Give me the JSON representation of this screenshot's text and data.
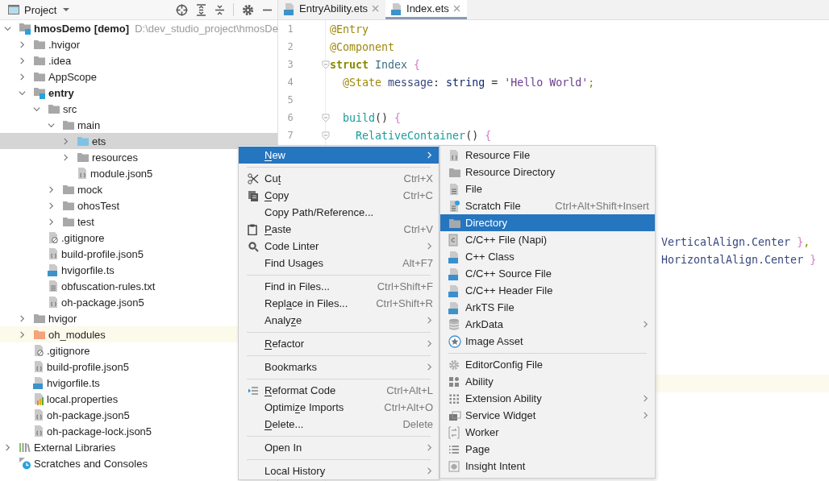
{
  "project_panel": {
    "title": "Project"
  },
  "tree": [
    {
      "label": "hmosDemo",
      "tag": "[demo]",
      "path": "D:\\dev_studio_project\\hmosDe",
      "kind": "module",
      "expanded": true,
      "selected": false,
      "highlighted": false,
      "children": [
        {
          "label": ".hvigor",
          "kind": "folder",
          "expanded": false,
          "selected": false,
          "highlighted": false
        },
        {
          "label": ".idea",
          "kind": "folder",
          "expanded": false,
          "selected": false,
          "highlighted": false
        },
        {
          "label": "AppScope",
          "kind": "folder",
          "expanded": false,
          "selected": false,
          "highlighted": false
        },
        {
          "label": "entry",
          "kind": "module",
          "expanded": true,
          "selected": false,
          "highlighted": false,
          "children": [
            {
              "label": "src",
              "kind": "folder",
              "expanded": true,
              "selected": false,
              "highlighted": false,
              "children": [
                {
                  "label": "main",
                  "kind": "folder",
                  "expanded": true,
                  "selected": false,
                  "highlighted": false,
                  "children": [
                    {
                      "label": "ets",
                      "kind": "source-folder",
                      "expanded": false,
                      "selected": true,
                      "highlighted": false
                    },
                    {
                      "label": "resources",
                      "kind": "folder",
                      "expanded": false,
                      "selected": false,
                      "highlighted": false
                    },
                    {
                      "label": "module.json5",
                      "kind": "json",
                      "selected": false,
                      "highlighted": false
                    }
                  ]
                },
                {
                  "label": "mock",
                  "kind": "folder",
                  "expanded": false,
                  "selected": false,
                  "highlighted": false
                },
                {
                  "label": "ohosTest",
                  "kind": "folder",
                  "expanded": false,
                  "selected": false,
                  "highlighted": false
                },
                {
                  "label": "test",
                  "kind": "folder",
                  "expanded": false,
                  "selected": false,
                  "highlighted": false
                }
              ]
            },
            {
              "label": ".gitignore",
              "kind": "ignore",
              "selected": false,
              "highlighted": false
            },
            {
              "label": "build-profile.json5",
              "kind": "json",
              "selected": false,
              "highlighted": false
            },
            {
              "label": "hvigorfile.ts",
              "kind": "ts",
              "selected": false,
              "highlighted": false
            },
            {
              "label": "obfuscation-rules.txt",
              "kind": "txt",
              "selected": false,
              "highlighted": false
            },
            {
              "label": "oh-package.json5",
              "kind": "json",
              "selected": false,
              "highlighted": false
            }
          ]
        },
        {
          "label": "hvigor",
          "kind": "folder",
          "expanded": false,
          "selected": false,
          "highlighted": false
        },
        {
          "label": "oh_modules",
          "kind": "excluded-folder",
          "expanded": false,
          "selected": false,
          "highlighted": true
        },
        {
          "label": ".gitignore",
          "kind": "ignore",
          "selected": false,
          "highlighted": false
        },
        {
          "label": "build-profile.json5",
          "kind": "json",
          "selected": false,
          "highlighted": false
        },
        {
          "label": "hvigorfile.ts",
          "kind": "ts",
          "selected": false,
          "highlighted": false
        },
        {
          "label": "local.properties",
          "kind": "properties",
          "selected": false,
          "highlighted": false
        },
        {
          "label": "oh-package.json5",
          "kind": "json",
          "selected": false,
          "highlighted": false
        },
        {
          "label": "oh-package-lock.json5",
          "kind": "json",
          "selected": false,
          "highlighted": false
        }
      ]
    },
    {
      "label": "External Libraries",
      "kind": "libraries",
      "expanded": false,
      "selected": false,
      "highlighted": false
    },
    {
      "label": "Scratches and Consoles",
      "kind": "scratches",
      "selected": false,
      "highlighted": false
    }
  ],
  "tabs": [
    {
      "label": "EntryAbility.ets",
      "selected": false
    },
    {
      "label": "Index.ets",
      "selected": true
    }
  ],
  "code_lines": [
    {
      "number": "1",
      "fold": false,
      "tokens": [
        {
          "text": "@Entry",
          "kind": "annotation"
        }
      ]
    },
    {
      "number": "2",
      "fold": false,
      "tokens": [
        {
          "text": "@Component",
          "kind": "annotation"
        }
      ]
    },
    {
      "number": "3",
      "fold": true,
      "tokens": [
        {
          "text": "struct",
          "kind": "keyword"
        },
        {
          "text": " Index",
          "kind": "type"
        },
        {
          "text": " {",
          "kind": "brace"
        }
      ]
    },
    {
      "number": "4",
      "fold": false,
      "tokens": [
        {
          "text": "  @State",
          "kind": "annotation"
        },
        {
          "text": " message",
          "kind": "field"
        },
        {
          "text": ": ",
          "kind": "plain"
        },
        {
          "text": "string",
          "kind": "builtin"
        },
        {
          "text": " = ",
          "kind": "plain"
        },
        {
          "text": "'Hello World'",
          "kind": "string"
        },
        {
          "text": ";",
          "kind": "punct"
        }
      ]
    },
    {
      "number": "5",
      "fold": false
    },
    {
      "number": "6",
      "fold": true,
      "tokens": [
        {
          "text": "  build",
          "kind": "func"
        },
        {
          "text": "()",
          "kind": "plain"
        },
        {
          "text": " {",
          "kind": "brace"
        }
      ]
    },
    {
      "number": "7",
      "fold": true,
      "tokens": [
        {
          "text": "    RelativeContainer",
          "kind": "func"
        },
        {
          "text": "()",
          "kind": "plain"
        },
        {
          "text": " {",
          "kind": "brace"
        }
      ]
    }
  ],
  "clipped_lines": [
    {
      "tokens": [
        {
          "text": "VerticalAlign",
          "kind": "field"
        },
        {
          "text": ".Center",
          "kind": "field"
        },
        {
          "text": " }",
          "kind": "brace"
        },
        {
          "text": ",",
          "kind": "punct"
        }
      ]
    },
    {
      "tokens": [
        {
          "text": "HorizontalAlign",
          "kind": "field"
        },
        {
          "text": ".Center",
          "kind": "field"
        },
        {
          "text": " }",
          "kind": "brace"
        }
      ]
    }
  ],
  "context_menu": {
    "items": [
      {
        "kind": "plain",
        "label": [
          {
            "text": "N",
            "underline": true
          },
          {
            "text": "ew",
            "underline": false
          }
        ],
        "arrow": true,
        "selected": true,
        "submenu": {
          "items": [
            {
              "kind": "resource-file",
              "label": "Resource File",
              "arrow": false,
              "selected": false
            },
            {
              "kind": "folder",
              "label": "Resource Directory",
              "arrow": false,
              "selected": false
            },
            {
              "kind": "file",
              "label": "File",
              "arrow": false,
              "selected": false
            },
            {
              "kind": "scratch",
              "label": "Scratch File",
              "shortcut": "Ctrl+Alt+Shift+Insert",
              "arrow": false,
              "selected": false
            },
            {
              "kind": "folder",
              "label": "Directory",
              "arrow": false,
              "selected": true
            },
            {
              "kind": "c-file",
              "label": "C/C++ File (Napi)",
              "arrow": false,
              "selected": false
            },
            {
              "kind": "cpp",
              "label": "C++ Class",
              "arrow": false,
              "selected": false
            },
            {
              "kind": "c-source",
              "label": "C/C++ Source File",
              "arrow": false,
              "selected": false
            },
            {
              "kind": "header",
              "label": "C/C++ Header File",
              "arrow": false,
              "selected": false
            },
            {
              "kind": "arkts",
              "label": "ArkTS File",
              "arrow": false,
              "selected": false
            },
            {
              "kind": "database",
              "label": "ArkData",
              "arrow": true,
              "selected": false
            },
            {
              "kind": "image-asset",
              "label": "Image Asset",
              "arrow": false,
              "selected": false
            },
            {
              "kind": "separator"
            },
            {
              "kind": "gear",
              "label": "EditorConfig File",
              "arrow": false,
              "selected": false
            },
            {
              "kind": "ability",
              "label": "Ability",
              "arrow": false,
              "selected": false
            },
            {
              "kind": "extension",
              "label": "Extension Ability",
              "arrow": true,
              "selected": false
            },
            {
              "kind": "widget",
              "label": "Service Widget",
              "arrow": true,
              "selected": false
            },
            {
              "kind": "worker",
              "label": "Worker",
              "arrow": false,
              "selected": false
            },
            {
              "kind": "page",
              "label": "Page",
              "arrow": false,
              "selected": false
            },
            {
              "kind": "insight",
              "label": "Insight Intent",
              "arrow": false,
              "selected": false
            }
          ]
        }
      },
      {
        "kind": "separator"
      },
      {
        "kind": "cut",
        "label": [
          {
            "text": "Cu",
            "underline": false
          },
          {
            "text": "t",
            "underline": true
          }
        ],
        "shortcut": "Ctrl+X",
        "arrow": false,
        "selected": false
      },
      {
        "kind": "copy",
        "label": [
          {
            "text": "C",
            "underline": true
          },
          {
            "text": "opy",
            "underline": false
          }
        ],
        "shortcut": "Ctrl+C",
        "arrow": false,
        "selected": false
      },
      {
        "kind": "plain",
        "label": "Copy Path/Reference...",
        "arrow": false,
        "selected": false
      },
      {
        "kind": "paste",
        "label": [
          {
            "text": "P",
            "underline": true
          },
          {
            "text": "aste",
            "underline": false
          }
        ],
        "shortcut": "Ctrl+V",
        "arrow": false,
        "selected": false
      },
      {
        "kind": "linter",
        "label": "Code Linter",
        "arrow": true,
        "selected": false
      },
      {
        "kind": "plain",
        "label": "Find Usages",
        "shortcut": "Alt+F7",
        "arrow": false,
        "selected": false
      },
      {
        "kind": "separator"
      },
      {
        "kind": "plain",
        "label": "Find in Files...",
        "shortcut": "Ctrl+Shift+F",
        "arrow": false,
        "selected": false
      },
      {
        "kind": "plain",
        "label": [
          {
            "text": "Repl",
            "underline": false
          },
          {
            "text": "a",
            "underline": true
          },
          {
            "text": "ce in Files...",
            "underline": false
          }
        ],
        "shortcut": "Ctrl+Shift+R",
        "arrow": false,
        "selected": false
      },
      {
        "kind": "plain",
        "label": [
          {
            "text": "Analy",
            "underline": false
          },
          {
            "text": "z",
            "underline": true
          },
          {
            "text": "e",
            "underline": false
          }
        ],
        "arrow": true,
        "selected": false
      },
      {
        "kind": "separator"
      },
      {
        "kind": "plain",
        "label": [
          {
            "text": "R",
            "underline": true
          },
          {
            "text": "efactor",
            "underline": false
          }
        ],
        "arrow": true,
        "selected": false
      },
      {
        "kind": "separator"
      },
      {
        "kind": "plain",
        "label": "Bookmarks",
        "arrow": true,
        "selected": false
      },
      {
        "kind": "separator"
      },
      {
        "kind": "reformat",
        "label": [
          {
            "text": "R",
            "underline": true
          },
          {
            "text": "eformat Code",
            "underline": false
          }
        ],
        "shortcut": "Ctrl+Alt+L",
        "arrow": false,
        "selected": false
      },
      {
        "kind": "plain",
        "label": [
          {
            "text": "Optimi",
            "underline": false
          },
          {
            "text": "z",
            "underline": true
          },
          {
            "text": "e Imports",
            "underline": false
          }
        ],
        "shortcut": "Ctrl+Alt+O",
        "arrow": false,
        "selected": false
      },
      {
        "kind": "plain",
        "label": [
          {
            "text": "D",
            "underline": true
          },
          {
            "text": "elete...",
            "underline": false
          }
        ],
        "shortcut": "Delete",
        "arrow": false,
        "selected": false
      },
      {
        "kind": "separator"
      },
      {
        "kind": "plain",
        "label": "Open In",
        "arrow": true,
        "selected": false
      },
      {
        "kind": "separator"
      },
      {
        "kind": "plain",
        "label": "Local History",
        "arrow": true,
        "selected": false
      }
    ]
  }
}
